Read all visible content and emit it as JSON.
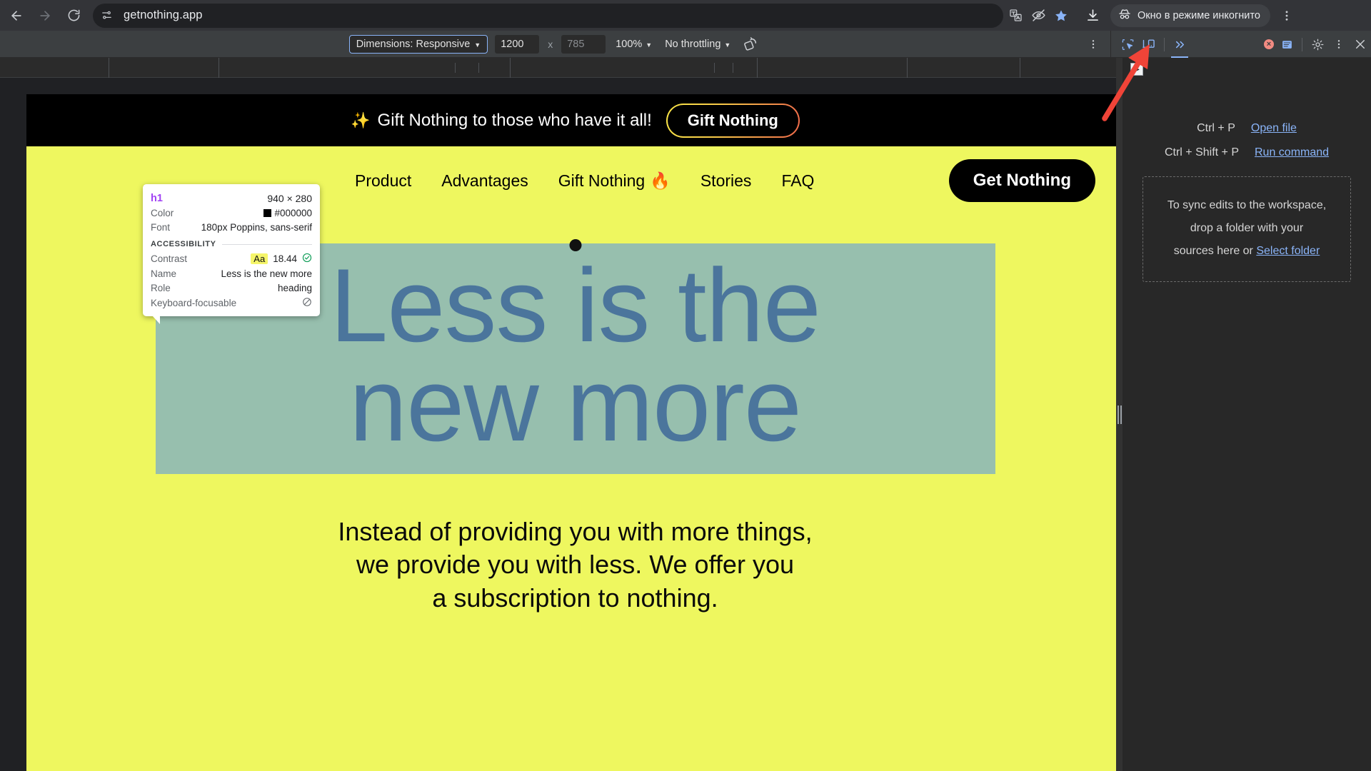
{
  "browser": {
    "url": "getnothing.app",
    "back_label": "Back",
    "forward_label": "Forward",
    "reload_label": "Reload",
    "site_info_label": "View site information",
    "translate_label": "translate-icon",
    "hide_label": "hide-icon",
    "bookmark_label": "bookmark-star-icon",
    "download_label": "download-icon",
    "incognito_label": "Окно в режиме инкогнито",
    "menu_label": "Customize and control Chrome"
  },
  "device_toolbar": {
    "dimensions_label": "Dimensions: Responsive",
    "width_value": "1200",
    "height_value": "785",
    "times": "x",
    "zoom_label": "100%",
    "throttling_label": "No throttling",
    "rotate_label": "rotate-icon",
    "more_options_label": "More options"
  },
  "devtools_toolbar": {
    "inspect_label": "inspect-element-icon",
    "device_toggle_label": "toggle-device-toolbar-icon",
    "more_panels_label": "More panels",
    "error_count": "",
    "console_label": "console-drawer-icon",
    "settings_label": "settings-gear-icon",
    "main_menu_label": "main-menu-icon",
    "close_label": "Close DevTools"
  },
  "inspector_tooltip": {
    "tag": "h1",
    "dimensions": "940 × 280",
    "color_key": "Color",
    "color_value": "#000000",
    "font_key": "Font",
    "font_value": "180px Poppins, sans-serif",
    "accessibility_header": "ACCESSIBILITY",
    "contrast_key": "Contrast",
    "contrast_chip": "Aa",
    "contrast_value": "18.44",
    "contrast_status": "pass",
    "name_key": "Name",
    "name_value": "Less is the new more",
    "role_key": "Role",
    "role_value": "heading",
    "focusable_key": "Keyboard-focusable",
    "focusable_value": "no"
  },
  "page": {
    "background_color": "#eef75f",
    "promo": {
      "sparkle_icon": "✨",
      "text": "Gift Nothing to those who have it all!",
      "cta_label": "Gift Nothing"
    },
    "nav": {
      "links": [
        {
          "label": "Product",
          "badge": ""
        },
        {
          "label": "Advantages",
          "badge": ""
        },
        {
          "label": "Gift Nothing",
          "badge": "🔥"
        },
        {
          "label": "Stories",
          "badge": ""
        },
        {
          "label": "FAQ",
          "badge": ""
        }
      ],
      "cta_label": "Get Nothing"
    },
    "hero": {
      "heading_line1": "Less is the",
      "heading_line2": "new more",
      "subtitle_line1": "Instead of providing you with more things,",
      "subtitle_line2": "we provide you with less. We offer you",
      "subtitle_line3": "a subscription to nothing.",
      "highlight_color": "#97bfae"
    }
  },
  "devtools_panel": {
    "hints": [
      {
        "keys": "Ctrl + P",
        "link": "Open file"
      },
      {
        "keys": "Ctrl + Shift + P",
        "link": "Run command"
      }
    ],
    "workspace": {
      "line1": "To sync edits to the workspace,",
      "line2": "drop a folder with your",
      "line3_prefix": "sources here or ",
      "line3_link": "Select folder"
    }
  },
  "annotation": {
    "arrow_label": "red-pointer-arrow",
    "arrow_color": "#f04438"
  }
}
